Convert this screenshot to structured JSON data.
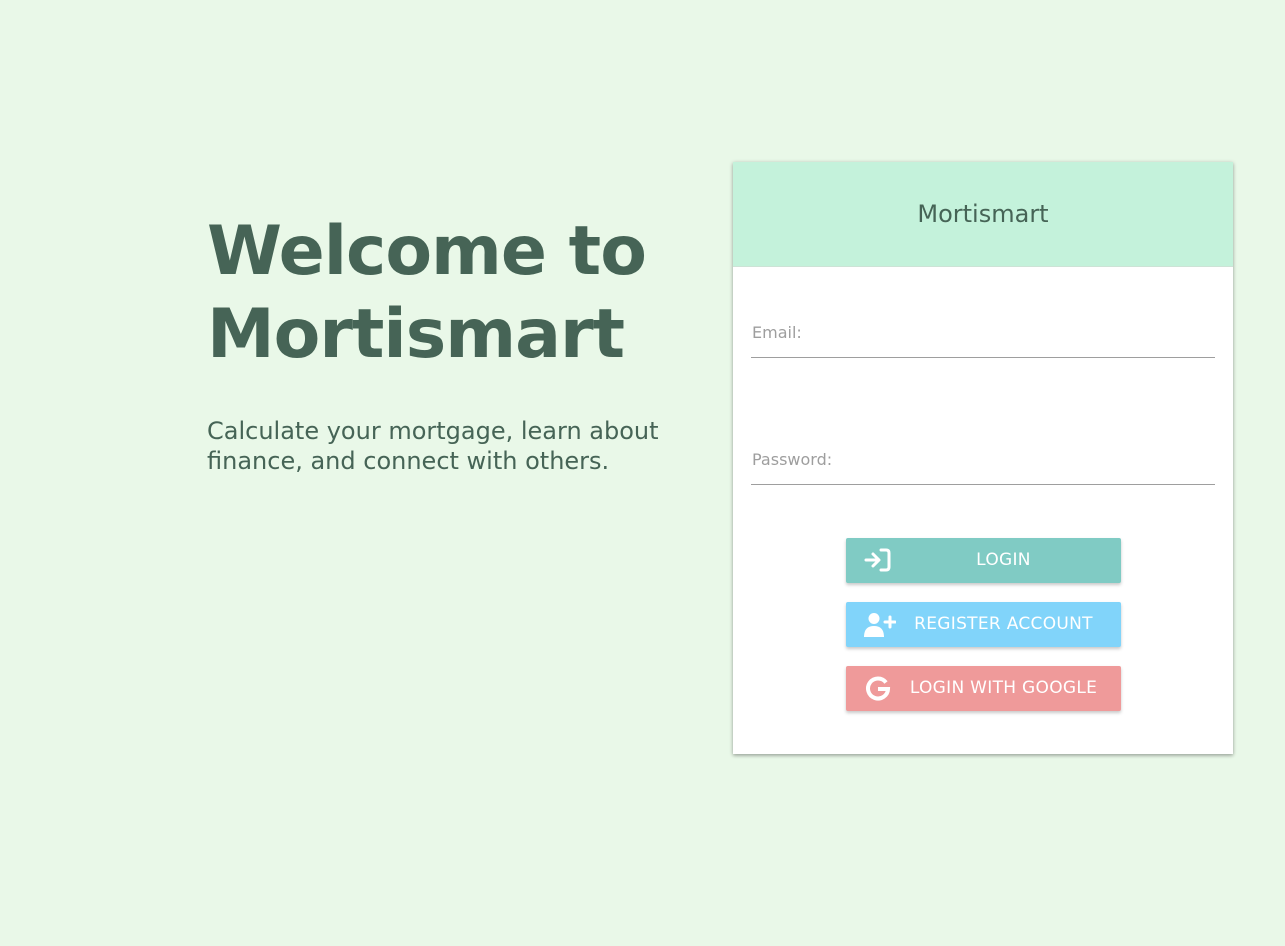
{
  "hero": {
    "title_line1": "Welcome to",
    "title_line2": "Mortismart",
    "subtitle_line1": "Calculate your mortgage, learn about",
    "subtitle_line2": "finance, and connect with others."
  },
  "login_card": {
    "title": "Mortismart",
    "email": {
      "label": "Email:",
      "value": ""
    },
    "password": {
      "label": "Password:",
      "value": ""
    },
    "buttons": {
      "login": {
        "label": "LOGIN",
        "icon": "sign-in-icon"
      },
      "register": {
        "label": "REGISTER ACCOUNT",
        "icon": "user-plus-icon"
      },
      "google": {
        "label": "LOGIN WITH GOOGLE",
        "icon": "google-icon"
      }
    }
  },
  "colors": {
    "background": "#e9f8e8",
    "text": "#466456",
    "card_header": "#c4f2db",
    "login_button": "#80cbc4",
    "register_button": "#81d4fa",
    "google_button": "#ef9a9a"
  }
}
